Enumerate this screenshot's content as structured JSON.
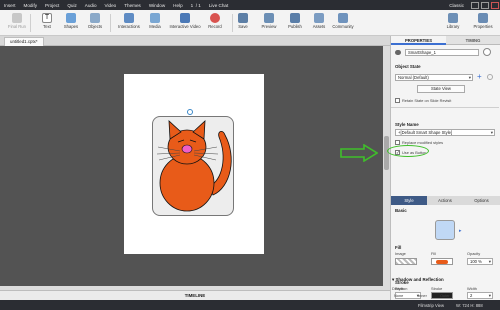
{
  "menubar": {
    "items": [
      "Insert",
      "Modify",
      "Project",
      "Quiz",
      "Audio",
      "Video",
      "Themes",
      "Window",
      "Help"
    ],
    "live_chat": "Live Chat",
    "mode": "Classic"
  },
  "toolbar": {
    "tools": [
      {
        "label": "Text"
      },
      {
        "label": "Shapes"
      },
      {
        "label": "Objects"
      },
      {
        "label": "Interactions"
      },
      {
        "label": "Media"
      },
      {
        "label": "Interactive Video"
      },
      {
        "label": "Record"
      },
      {
        "label": "Save"
      },
      {
        "label": "Preview"
      },
      {
        "label": "Publish"
      },
      {
        "label": "Assets"
      },
      {
        "label": "Community"
      }
    ],
    "library": "Library",
    "properties": "Properties",
    "first_label": "Final Run"
  },
  "document": {
    "tab_name": "untitled1.cptx*"
  },
  "timeline": {
    "label": "TIMELINE"
  },
  "status": {
    "view": "Filmstrip View",
    "size": "W: 724 H: 888"
  },
  "panel": {
    "tabs": [
      "PROPERTIES",
      "TIMING"
    ],
    "shape_name": "SmartShape_1",
    "object_state_label": "Object State",
    "state_value": "Normal (Default)",
    "state_view_button": "State View",
    "retain_state_label": "Retain State on Slide Revisit",
    "style_name_label": "Style Name",
    "style_value": "+[Default Smart Shape Style]",
    "replace_styles_label": "Replace modified styles",
    "use_as_button_label": "Use as Button",
    "subtabs": [
      "Style",
      "Actions",
      "Options"
    ],
    "basic_label": "Basic",
    "fill_label": "Fill",
    "image_label": "Image",
    "fill_sub_label": "Fill",
    "opacity_label": "Opacity",
    "opacity_value": "100 %",
    "stroke_label": "Stroke",
    "stroke_style_label": "Style",
    "stroke_stroke_label": "Stroke",
    "stroke_width_label": "Width",
    "stroke_width_value": "2",
    "shadow_label": "Shadow and Reflection",
    "direction_label": "Direction",
    "direction_options": [
      "None",
      "Inner",
      "Outer"
    ],
    "fill_swatch_color": "#c0d8f5",
    "fill_color": "#e85b19",
    "arrow_color": "#3fbf2a"
  }
}
